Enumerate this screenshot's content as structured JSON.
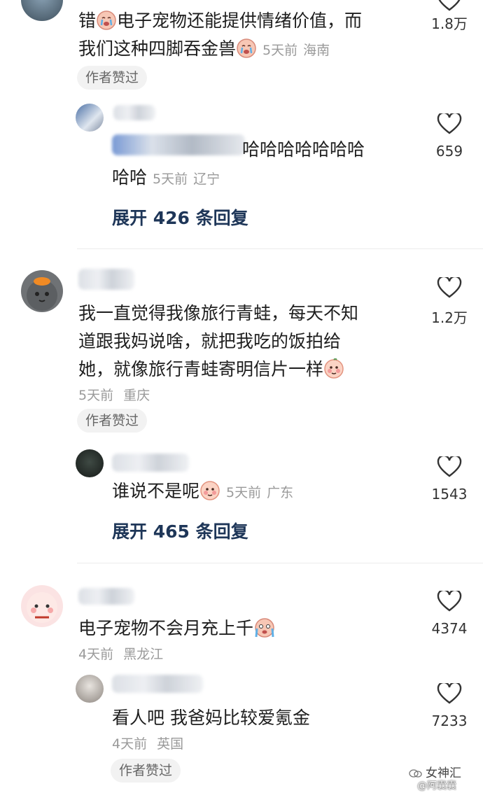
{
  "comments": [
    {
      "line1": "错",
      "line1b": "电子宠物还能提供情绪价值，而",
      "line2": "我们这种四脚吞金兽",
      "time": "5天前",
      "location": "海南",
      "likes": "1.8万",
      "badge": "作者赞过",
      "reply": {
        "line1": "哈哈哈哈哈哈哈",
        "line2": "哈哈",
        "time": "5天前",
        "location": "辽宁",
        "likes": "659"
      },
      "expand": "展开 426 条回复"
    },
    {
      "lines": [
        "我一直觉得我像旅行青蛙，每天不知",
        "道跟我妈说啥，就把我吃的饭拍给",
        "她，就像旅行青蛙寄明信片一样"
      ],
      "time": "5天前",
      "location": "重庆",
      "likes": "1.2万",
      "badge": "作者赞过",
      "reply": {
        "text": "谁说不是呢",
        "time": "5天前",
        "location": "广东",
        "likes": "1543"
      },
      "expand": "展开 465 条回复"
    },
    {
      "text": "电子宠物不会月充上千",
      "time": "4天前",
      "location": "黑龙江",
      "likes": "4374",
      "reply": {
        "text": "看人吧 我爸妈比较爱氪金",
        "time": "4天前",
        "location": "英国",
        "likes": "7233",
        "badge": "作者赞过"
      }
    }
  ],
  "watermark": {
    "brand": "女神汇",
    "handle": "@阿囊囊"
  },
  "colors": {
    "accent_link": "#1e3658",
    "meta": "#9a9a9a",
    "badge_bg": "#f2f2f2"
  },
  "icons": {
    "like": "heart-outline-icon",
    "emoji_cry": "crying-emoji-icon",
    "emoji_shy": "blushing-emoji-icon"
  }
}
